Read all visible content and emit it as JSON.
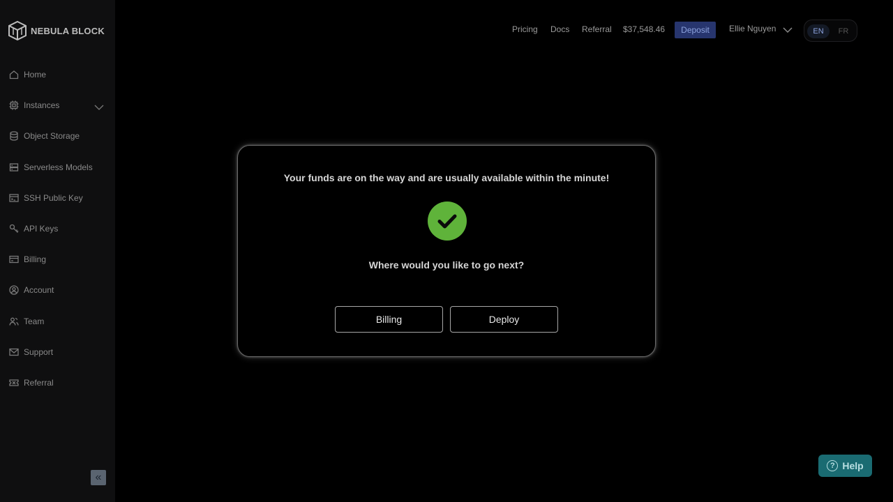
{
  "sidebar": {
    "logo_text": "NEBULA BLOCK",
    "items": [
      {
        "label": "Home",
        "icon": "home-icon"
      },
      {
        "label": "Instances",
        "icon": "cpu-icon"
      },
      {
        "label": "Object Storage",
        "icon": "database-icon"
      },
      {
        "label": "Serverless Models",
        "icon": "server-icon"
      },
      {
        "label": "SSH Public Key",
        "icon": "terminal-icon"
      },
      {
        "label": "API Keys",
        "icon": "key-icon"
      },
      {
        "label": "Billing",
        "icon": "credit-card-icon"
      },
      {
        "label": "Account",
        "icon": "user-circle-icon"
      },
      {
        "label": "Team",
        "icon": "team-icon"
      },
      {
        "label": "Support",
        "icon": "mail-icon"
      },
      {
        "label": "Referral",
        "icon": "ticket-icon"
      }
    ],
    "collapse_glyph": "«"
  },
  "header": {
    "pricing": "Pricing",
    "docs": "Docs",
    "referral": "Referral",
    "balance": "$37,548.46",
    "deposit": "Deposit",
    "user_name": "Ellie Nguyen",
    "lang_en": "EN",
    "lang_fr": "FR"
  },
  "modal": {
    "message": "Your funds are on the way and are usually available within the minute!",
    "question": "Where would you like to go next?",
    "billing_button": "Billing",
    "deploy_button": "Deploy"
  },
  "help": {
    "label": "Help",
    "glyph": "?"
  },
  "colors": {
    "accent_deposit": "#27356e",
    "success": "#5fb33a",
    "help_bg": "#1a6b72"
  }
}
